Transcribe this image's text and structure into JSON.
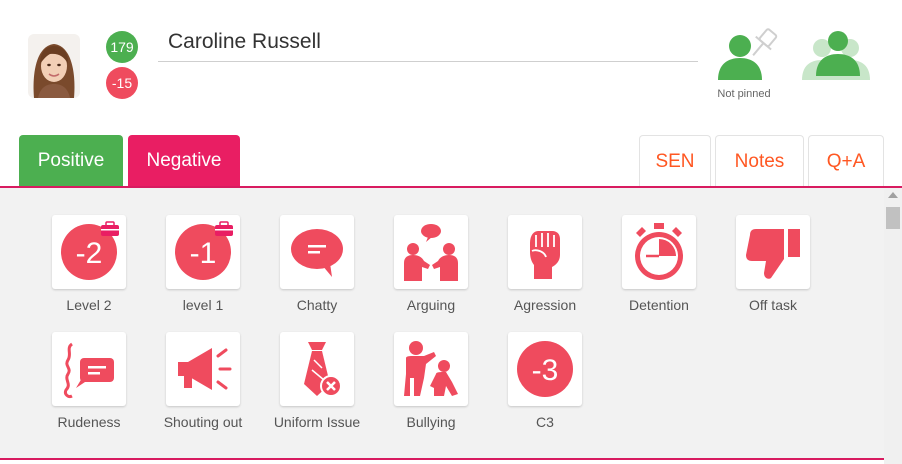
{
  "student": {
    "name": "Caroline Russell",
    "positive_points": "179",
    "negative_points": "-15"
  },
  "pin": {
    "status_label": "Not pinned"
  },
  "tabs": {
    "positive": "Positive",
    "negative": "Negative",
    "sen": "SEN",
    "notes": "Notes",
    "qa": "Q+A"
  },
  "behaviours": [
    {
      "label": "Level 2",
      "icon": "level-badge-icon",
      "badge_text": "-2",
      "has_case": true
    },
    {
      "label": "level 1",
      "icon": "level-badge-icon",
      "badge_text": "-1",
      "has_case": true
    },
    {
      "label": "Chatty",
      "icon": "speech-bubble-icon"
    },
    {
      "label": "Arguing",
      "icon": "arguing-people-icon"
    },
    {
      "label": "Agression",
      "icon": "clenched-fist-icon"
    },
    {
      "label": "Detention",
      "icon": "stopwatch-icon"
    },
    {
      "label": "Off task",
      "icon": "thumbs-down-icon"
    },
    {
      "label": "Rudeness",
      "icon": "rude-speech-icon"
    },
    {
      "label": "Shouting out",
      "icon": "megaphone-icon"
    },
    {
      "label": "Uniform Issue",
      "icon": "tie-icon"
    },
    {
      "label": "Bullying",
      "icon": "bullying-icon"
    },
    {
      "label": "C3",
      "icon": "level-badge-icon",
      "badge_text": "-3"
    }
  ],
  "colors": {
    "positive": "#4caf50",
    "negative": "#ef4b5e",
    "negative_tab": "#e91e63",
    "accent_text": "#ff5722",
    "rule": "#d81b60"
  }
}
